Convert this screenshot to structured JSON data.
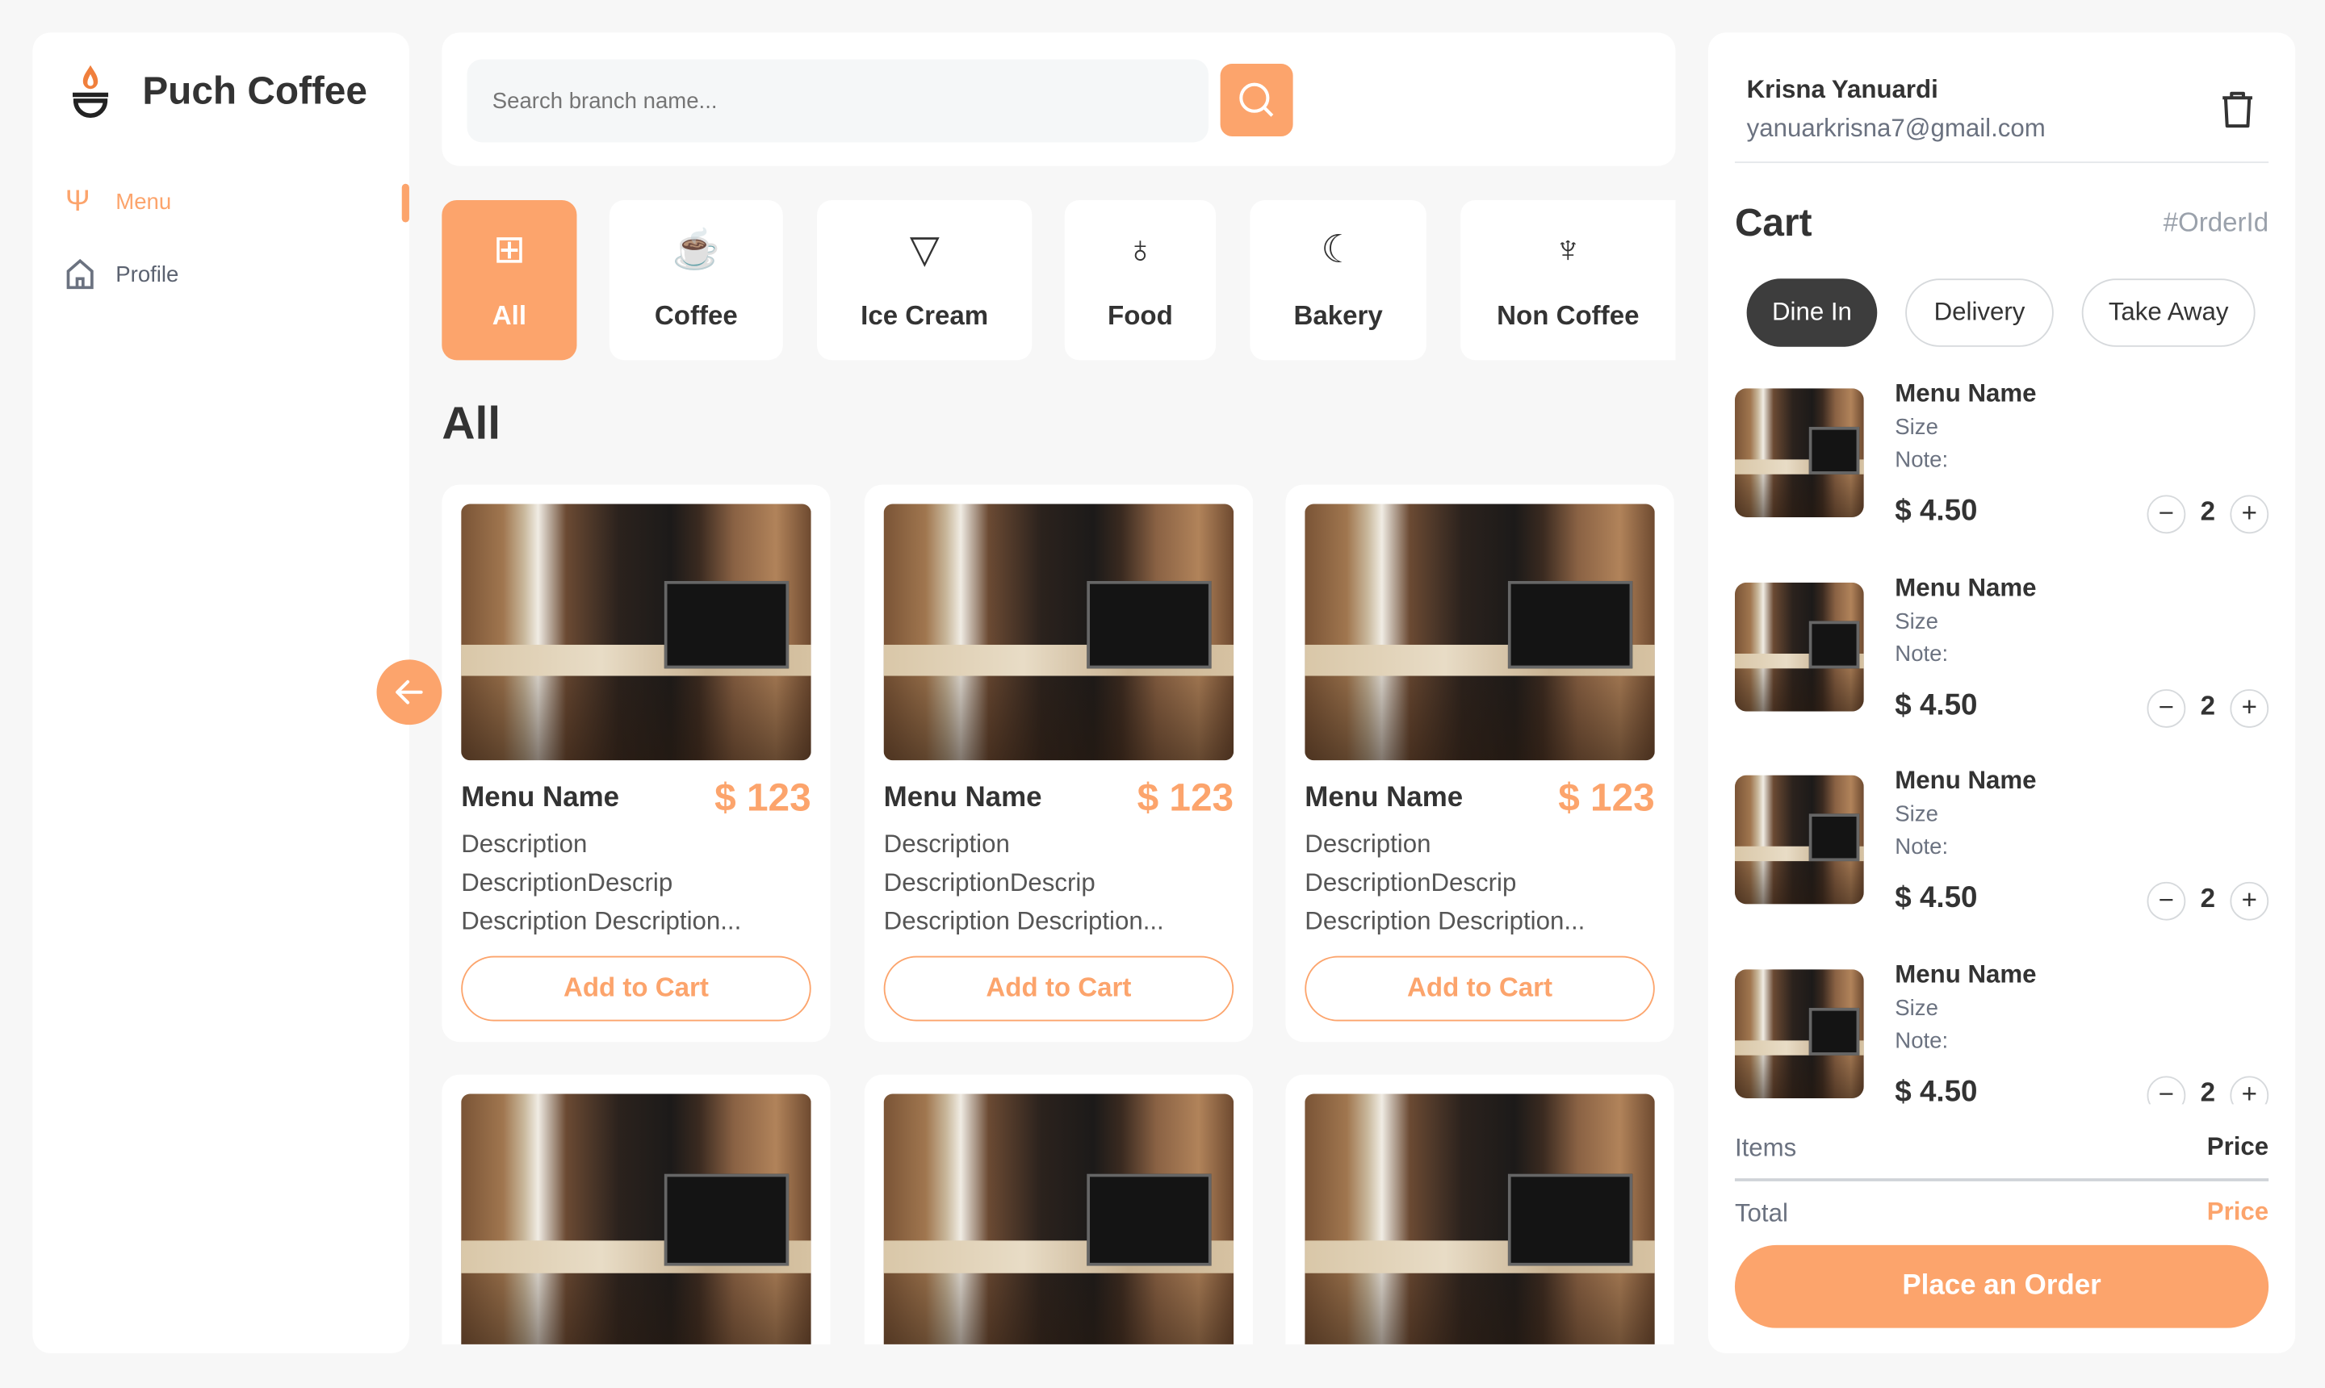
{
  "brand": {
    "name": "Puch Coffee",
    "accent": "#fca46c"
  },
  "sidebar": {
    "items": [
      {
        "label": "Menu",
        "icon": "utensils-icon",
        "active": true
      },
      {
        "label": "Profile",
        "icon": "home-icon",
        "active": false
      }
    ]
  },
  "search": {
    "placeholder": "Search branch name..."
  },
  "categories": [
    {
      "label": "All",
      "icon": "grid-icon"
    },
    {
      "label": "Coffee",
      "icon": "coffee-cup-icon"
    },
    {
      "label": "Ice Cream",
      "icon": "ice-cream-icon"
    },
    {
      "label": "Food",
      "icon": "drumstick-icon"
    },
    {
      "label": "Bakery",
      "icon": "croissant-icon"
    },
    {
      "label": "Non Coffee",
      "icon": "cup-straw-icon"
    }
  ],
  "section_title": "All",
  "menu_items": [
    {
      "name": "Menu Name",
      "price": "$ 123",
      "desc": [
        "Description",
        "DescriptionDescrip",
        "Description Description..."
      ],
      "button": "Add to Cart"
    },
    {
      "name": "Menu Name",
      "price": "$ 123",
      "desc": [
        "Description",
        "DescriptionDescrip",
        "Description Description..."
      ],
      "button": "Add to Cart"
    },
    {
      "name": "Menu Name",
      "price": "$ 123",
      "desc": [
        "Description",
        "DescriptionDescrip",
        "Description Description..."
      ],
      "button": "Add to Cart"
    }
  ],
  "user": {
    "name": "Krisna Yanuardi",
    "email": "yanuarkrisna7@gmail.com"
  },
  "cart": {
    "title": "Cart",
    "order_id": "#OrderId",
    "order_types": [
      "Dine In",
      "Delivery",
      "Take Away"
    ],
    "selected_type": "Dine In",
    "items": [
      {
        "name": "Menu Name",
        "size": "Size",
        "note": "Note:",
        "price": "$ 4.50",
        "qty": "2"
      },
      {
        "name": "Menu Name",
        "size": "Size",
        "note": "Note:",
        "price": "$ 4.50",
        "qty": "2"
      },
      {
        "name": "Menu Name",
        "size": "Size",
        "note": "Note:",
        "price": "$ 4.50",
        "qty": "2"
      },
      {
        "name": "Menu Name",
        "size": "Size",
        "note": "Note:",
        "price": "$ 4.50",
        "qty": "2"
      }
    ],
    "items_label": "Items",
    "items_value": "Price",
    "total_label": "Total",
    "total_value": "Price",
    "place_order": "Place an Order"
  }
}
